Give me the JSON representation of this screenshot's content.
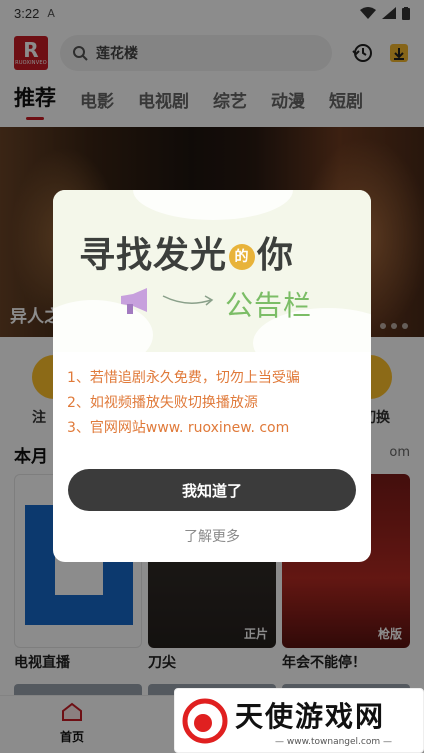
{
  "status_bar": {
    "time": "3:22",
    "notif_icon": "A"
  },
  "header": {
    "logo_big": "R",
    "logo_small": "RUOXINVEO",
    "search_text": "莲花楼"
  },
  "tabs": [
    "推荐",
    "电影",
    "电视剧",
    "综艺",
    "动漫",
    "短剧"
  ],
  "banner": {
    "title": "异人之"
  },
  "quick": [
    {
      "label": "注"
    },
    {
      "label": "切换"
    }
  ],
  "section": {
    "title": "本月",
    "more": "om"
  },
  "cards": [
    {
      "label": "电视直播",
      "badge": ""
    },
    {
      "label": "刀尖",
      "badge": "正片"
    },
    {
      "label": "年会不能停！",
      "badge": "枪版"
    }
  ],
  "bottom_nav": {
    "home": "首页"
  },
  "dialog": {
    "headline_a": "寻找发光",
    "headline_de": "的",
    "headline_b": "你",
    "subtitle": "公告栏",
    "lines": [
      "1、若惜追剧永久免费，切勿上当受骗",
      "2、如视频播放失败切换播放源",
      "3、官网网站www. ruoxinew. com"
    ],
    "confirm": "我知道了",
    "learn_more": "了解更多"
  },
  "watermark": {
    "text": "天使游戏网",
    "url": "— www.townangel.com —"
  },
  "colors": {
    "brand": "#c81d25",
    "dialog_button": "#3b3b3b",
    "notice_text": "#e07a3a",
    "subtitle_green": "#7bbd66"
  }
}
